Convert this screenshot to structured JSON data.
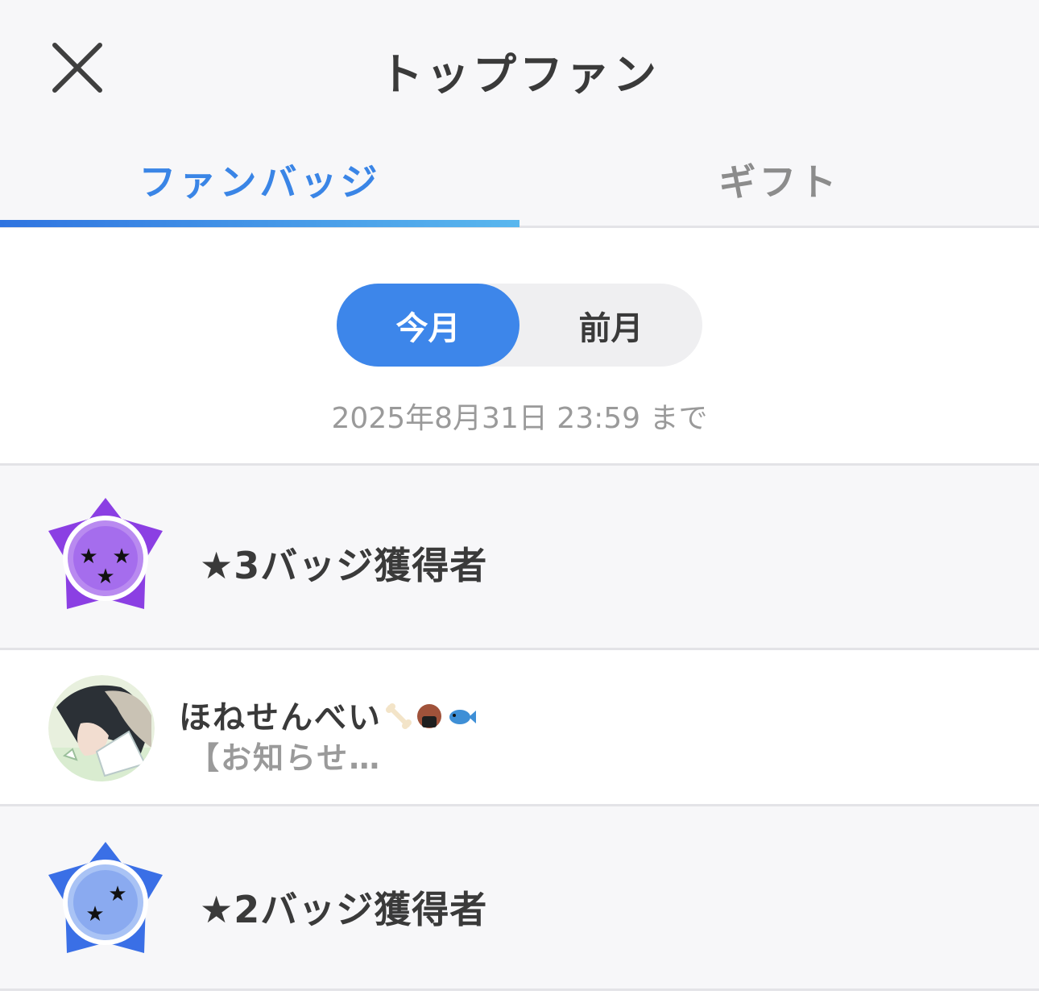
{
  "header": {
    "title": "トップファン",
    "close_icon": "close-icon"
  },
  "tabs": [
    {
      "label": "ファンバッジ",
      "active": true
    },
    {
      "label": "ギフト",
      "active": false
    }
  ],
  "period": {
    "options": [
      {
        "label": "今月",
        "selected": true
      },
      {
        "label": "前月",
        "selected": false
      }
    ],
    "deadline": "2025年8月31日 23:59 まで"
  },
  "sections": [
    {
      "badge_icon": "purple-star-badge-icon",
      "label": "★3バッジ獲得者",
      "color": "#8a3fe0"
    },
    {
      "badge_icon": "blue-star-badge-icon",
      "label": "★2バッジ獲得者",
      "color": "#3a6fe6"
    }
  ],
  "users": [
    {
      "name": "ほねせんべい",
      "name_emojis": [
        "bone-icon",
        "rice-cracker-icon",
        "fish-icon"
      ],
      "subtitle": "【お知らせ…"
    }
  ],
  "colors": {
    "accent": "#3d86ea",
    "tab_active": "#3a85e6",
    "tab_inactive": "#8c8c8c",
    "background": "#f7f7f9",
    "divider": "#e3e3e7"
  }
}
